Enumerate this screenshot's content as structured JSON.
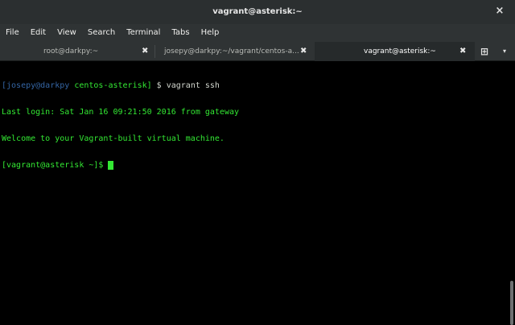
{
  "window": {
    "title": "vagrant@asterisk:~",
    "close_glyph": "×"
  },
  "menu": [
    {
      "label": "File"
    },
    {
      "label": "Edit"
    },
    {
      "label": "View"
    },
    {
      "label": "Search"
    },
    {
      "label": "Terminal"
    },
    {
      "label": "Tabs"
    },
    {
      "label": "Help"
    }
  ],
  "tabs": [
    {
      "label": "root@darkpy:~",
      "active": false
    },
    {
      "label": "josepy@darkpy:~/vagrant/centos-a...",
      "active": false
    },
    {
      "label": "vagrant@asterisk:~",
      "active": true
    }
  ],
  "tab_close_glyph": "✖",
  "new_tab_glyph": "⊞",
  "tab_menu_glyph": "▾",
  "terminal": {
    "prompt1_user": "[josepy@darkpy",
    "prompt1_dir": " centos-asterisk]",
    "prompt1_cmd": " $ vagrant ssh",
    "line2": "Last login: Sat Jan 16 09:21:50 2016 from gateway",
    "line3": "Welcome to your Vagrant-built virtual machine.",
    "prompt2": "[vagrant@asterisk ~]$ "
  },
  "colors": {
    "prompt_blue": "#3465a4",
    "text_green": "#33e833",
    "background": "#000000"
  }
}
